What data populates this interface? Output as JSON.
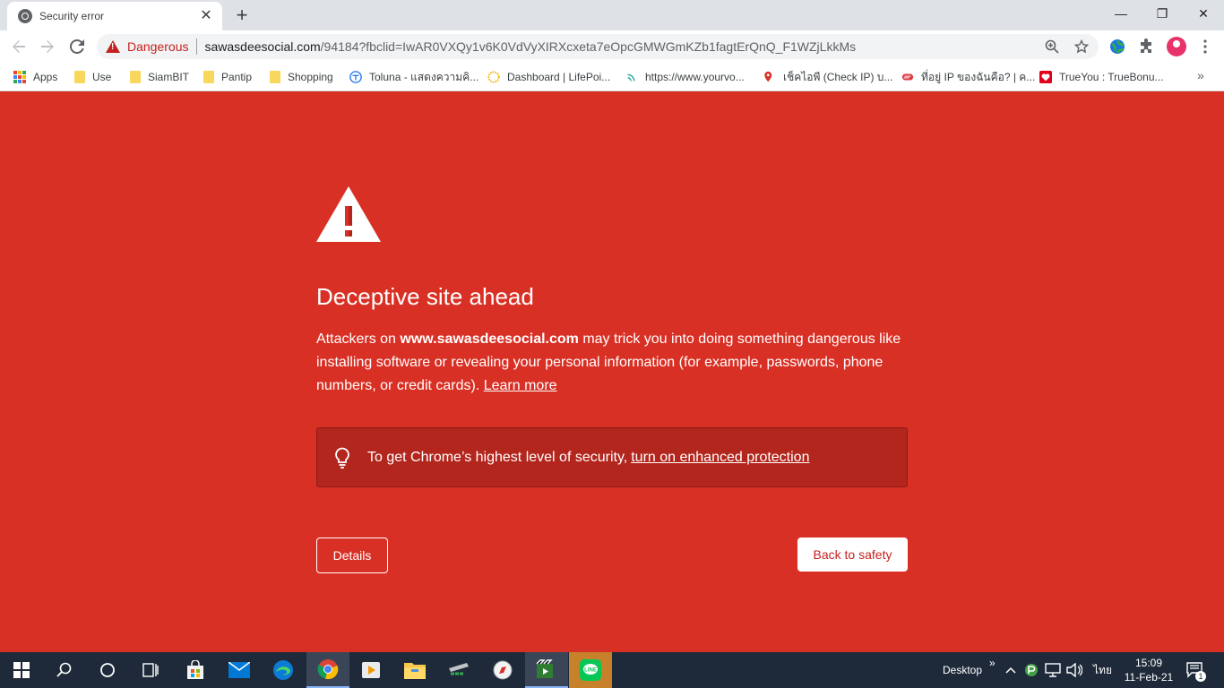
{
  "tab": {
    "title": "Security error",
    "close": "✕"
  },
  "newtab": "+",
  "window": {
    "minimize": "—",
    "restore": "❐",
    "close": "✕"
  },
  "omnibox": {
    "security_label": "Dangerous",
    "url_host": "sawasdeesocial.com",
    "url_path": "/94184?fbclid=IwAR0VXQy1v6K0VdVyXIRXcxeta7eOpcGMWGmKZb1fagtErQnQ_F1WZjLkkMs"
  },
  "bookmarks": [
    {
      "label": "Apps",
      "icon": "apps-grid-icon"
    },
    {
      "label": "Use",
      "icon": "folder-icon"
    },
    {
      "label": "SiamBIT",
      "icon": "folder-icon"
    },
    {
      "label": "Pantip",
      "icon": "folder-icon"
    },
    {
      "label": "Shopping",
      "icon": "folder-icon"
    },
    {
      "label": "Toluna - แสดงความคิ...",
      "icon": "toluna-icon"
    },
    {
      "label": "Dashboard | LifePoi...",
      "icon": "lifepoints-icon"
    },
    {
      "label": "https://www.yourvo...",
      "icon": "signal-icon"
    },
    {
      "label": "เช็คไอพี (Check IP) บ...",
      "icon": "ip-pin-icon"
    },
    {
      "label": "ที่อยู่ IP ของฉันคือ? | ค...",
      "icon": "expressvpn-icon"
    },
    {
      "label": "TrueYou : TrueBonu...",
      "icon": "trueyou-icon"
    }
  ],
  "bookmarks_more": "»",
  "interstitial": {
    "heading": "Deceptive site ahead",
    "msg_pre": "Attackers on ",
    "msg_site": "www.sawasdeesocial.com",
    "msg_post": " may trick you into doing something dangerous like installing software or revealing your personal information (for example, passwords, phone numbers, or credit cards). ",
    "learn_more": "Learn more",
    "enhanced_text": "To get Chrome’s highest level of security,",
    "enhanced_link": "turn on enhanced protection",
    "details_button": "Details",
    "safety_button": "Back to safety"
  },
  "taskbar": {
    "desktop_label": "Desktop",
    "desktop_chevron": "»",
    "language": "ไทย",
    "time": "15:09",
    "date": "11-Feb-21",
    "notification_count": "1"
  },
  "colors": {
    "danger": "#d93025",
    "danger_dark": "#b3261e",
    "chrome_tab": "#dee1e6",
    "taskbar": "#1e2a3a"
  }
}
